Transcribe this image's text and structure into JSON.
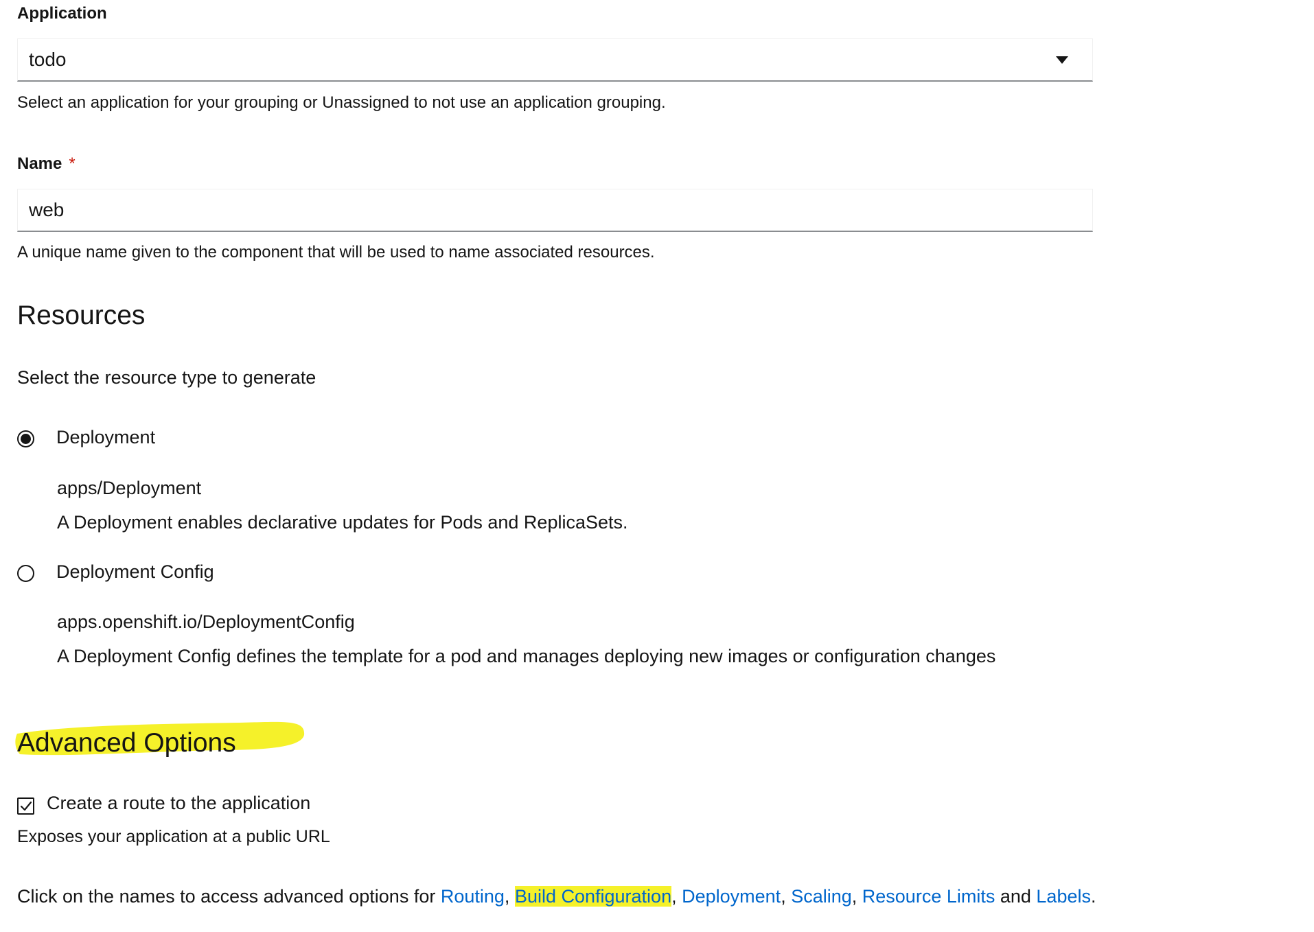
{
  "application": {
    "label": "Application",
    "selected_value": "todo",
    "helper": "Select an application for your grouping or Unassigned to not use an application grouping."
  },
  "name_field": {
    "label": "Name",
    "required_mark": "*",
    "value": "web",
    "helper": "A unique name given to the component that will be used to name associated resources."
  },
  "resources": {
    "title": "Resources",
    "prompt": "Select the resource type to generate",
    "options": [
      {
        "label": "Deployment",
        "api": "apps/Deployment",
        "description": "A Deployment enables declarative updates for Pods and ReplicaSets.",
        "checked": true
      },
      {
        "label": "Deployment Config",
        "api": "apps.openshift.io/DeploymentConfig",
        "description": "A Deployment Config defines the template for a pod and manages deploying new images or configuration changes",
        "checked": false
      }
    ]
  },
  "advanced": {
    "title": "Advanced Options",
    "route_checkbox_label": "Create a route to the application",
    "route_checked": true,
    "route_helper": "Exposes your application at a public URL",
    "links_intro": "Click on the names to access advanced options for ",
    "links": [
      "Routing",
      "Build Configuration",
      "Deployment",
      "Scaling",
      "Resource Limits",
      "Labels"
    ],
    "separator": ", ",
    "and_word": " and ",
    "end": "."
  },
  "colors": {
    "link": "#0066cc",
    "highlighter": "#f5f12a",
    "required": "#c9190b"
  }
}
